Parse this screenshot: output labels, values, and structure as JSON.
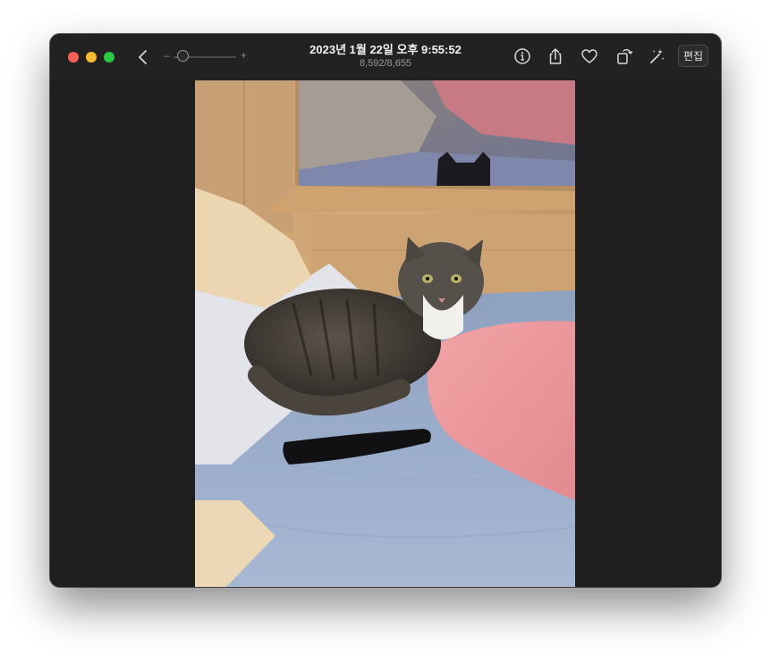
{
  "window": {
    "title": "2023년 1월 22일 오후 9:55:52",
    "counter": "8,592/8,655",
    "edit_label": "편집"
  },
  "zoom": {
    "minus": "–",
    "plus": "+",
    "level": 0.08
  },
  "icons": {
    "back": "chevron-left-icon",
    "info": "info-icon",
    "share": "share-icon",
    "favorite": "heart-icon",
    "rotate": "rotate-icon",
    "enhance": "magic-wand-icon"
  },
  "colors": {
    "close": "#fe5f57",
    "minimize": "#febc2e",
    "zoom": "#28c840",
    "chrome": "#1e1e1e"
  },
  "photo": {
    "subject": "cat"
  }
}
